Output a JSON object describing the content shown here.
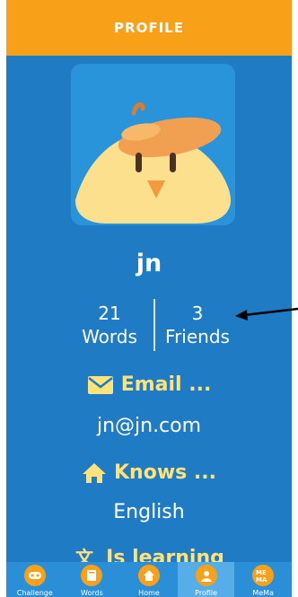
{
  "header": {
    "title": "PROFILE"
  },
  "profile": {
    "username": "jn",
    "stats": {
      "words_count": "21",
      "words_label": "Words",
      "friends_count": "3",
      "friends_label": "Friends"
    }
  },
  "sections": {
    "email": {
      "heading": "Email ...",
      "value": "jn@jn.com",
      "icon": "envelope-icon"
    },
    "knows": {
      "heading": "Knows ...",
      "value": "English",
      "icon": "home-icon"
    },
    "learning": {
      "heading": "Is learning",
      "icon": "translate-icon"
    }
  },
  "tabbar": {
    "tabs": [
      {
        "label": "Challenge",
        "icon": "gamepad-icon"
      },
      {
        "label": "Words",
        "icon": "book-icon"
      },
      {
        "label": "Home",
        "icon": "home-icon"
      },
      {
        "label": "Profile",
        "icon": "user-icon"
      },
      {
        "label": "MeMa",
        "icon": "mema-logo-icon"
      }
    ],
    "active": "Profile"
  },
  "colors": {
    "header": "#f8a018",
    "background": "#1f7bc4",
    "accent_yellow": "#ffe27a",
    "tab_active": "#55aee8"
  }
}
